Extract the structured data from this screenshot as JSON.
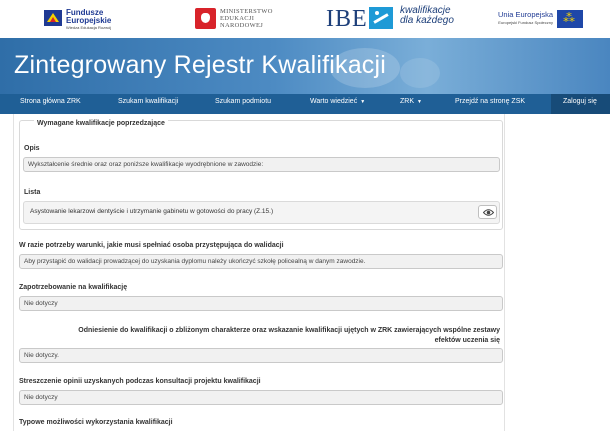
{
  "logos": {
    "fe_title": "Fundusze",
    "fe_title2": "Europejskie",
    "fe_sub": "Wiedza Edukacja Rozwój",
    "men_line1": "MINISTERSTWO",
    "men_line2": "EDUKACJI",
    "men_line3": "NARODOWEJ",
    "ibe": "IBE",
    "kdk_line1": "kwalifikacje",
    "kdk_line2": "dla każdego",
    "ue_title": "Unia Europejska",
    "ue_sub": "Europejski Fundusz Społeczny"
  },
  "banner": {
    "title": "Zintegrowany Rejestr Kwalifikacji"
  },
  "nav": {
    "home": "Strona główna ZRK",
    "search_qual": "Szukam kwalifikacji",
    "search_entity": "Szukam podmiotu",
    "worth_knowing": "Warto wiedzieć",
    "zrk": "ZRK",
    "go_to_zsk": "Przejdź na stronę ZSK",
    "login": "Zaloguj się"
  },
  "required_prior": {
    "legend": "Wymagane kwalifikacje poprzedzające",
    "desc_label": "Opis",
    "desc_value": "Wykształcenie średnie oraz oraz poniższe kwalifikacje wyodrębnione w zawodzie:",
    "list_label": "Lista",
    "list_item": "Asystowanie lekarzowi dentyście i utrzymanie gabinetu w gotowości do pracy (Z.15.)"
  },
  "conditions": {
    "label": "W razie potrzeby warunki, jakie musi spełniać osoba przystępująca do walidacji",
    "value": "Aby przystąpić do walidacji prowadzącej do uzyskania dyplomu należy ukończyć szkołę policealną w danym zawodzie."
  },
  "demand": {
    "label": "Zapotrzebowanie na kwalifikację",
    "value": "Nie dotyczy"
  },
  "similar": {
    "label_line1": "Odniesienie do kwalifikacji o zbliżonym charakterze oraz wskazanie kwalifikacji ujętych w ZRK zawierających wspólne zestawy",
    "label_line2": "efektów uczenia się",
    "value": "Nie dotyczy."
  },
  "opinions": {
    "label": "Streszczenie opinii uzyskanych podczas konsultacji projektu kwalifikacji",
    "value": "Nie dotyczy"
  },
  "typical_use": {
    "label": "Typowe możliwości wykorzystania kwalifikacji"
  }
}
